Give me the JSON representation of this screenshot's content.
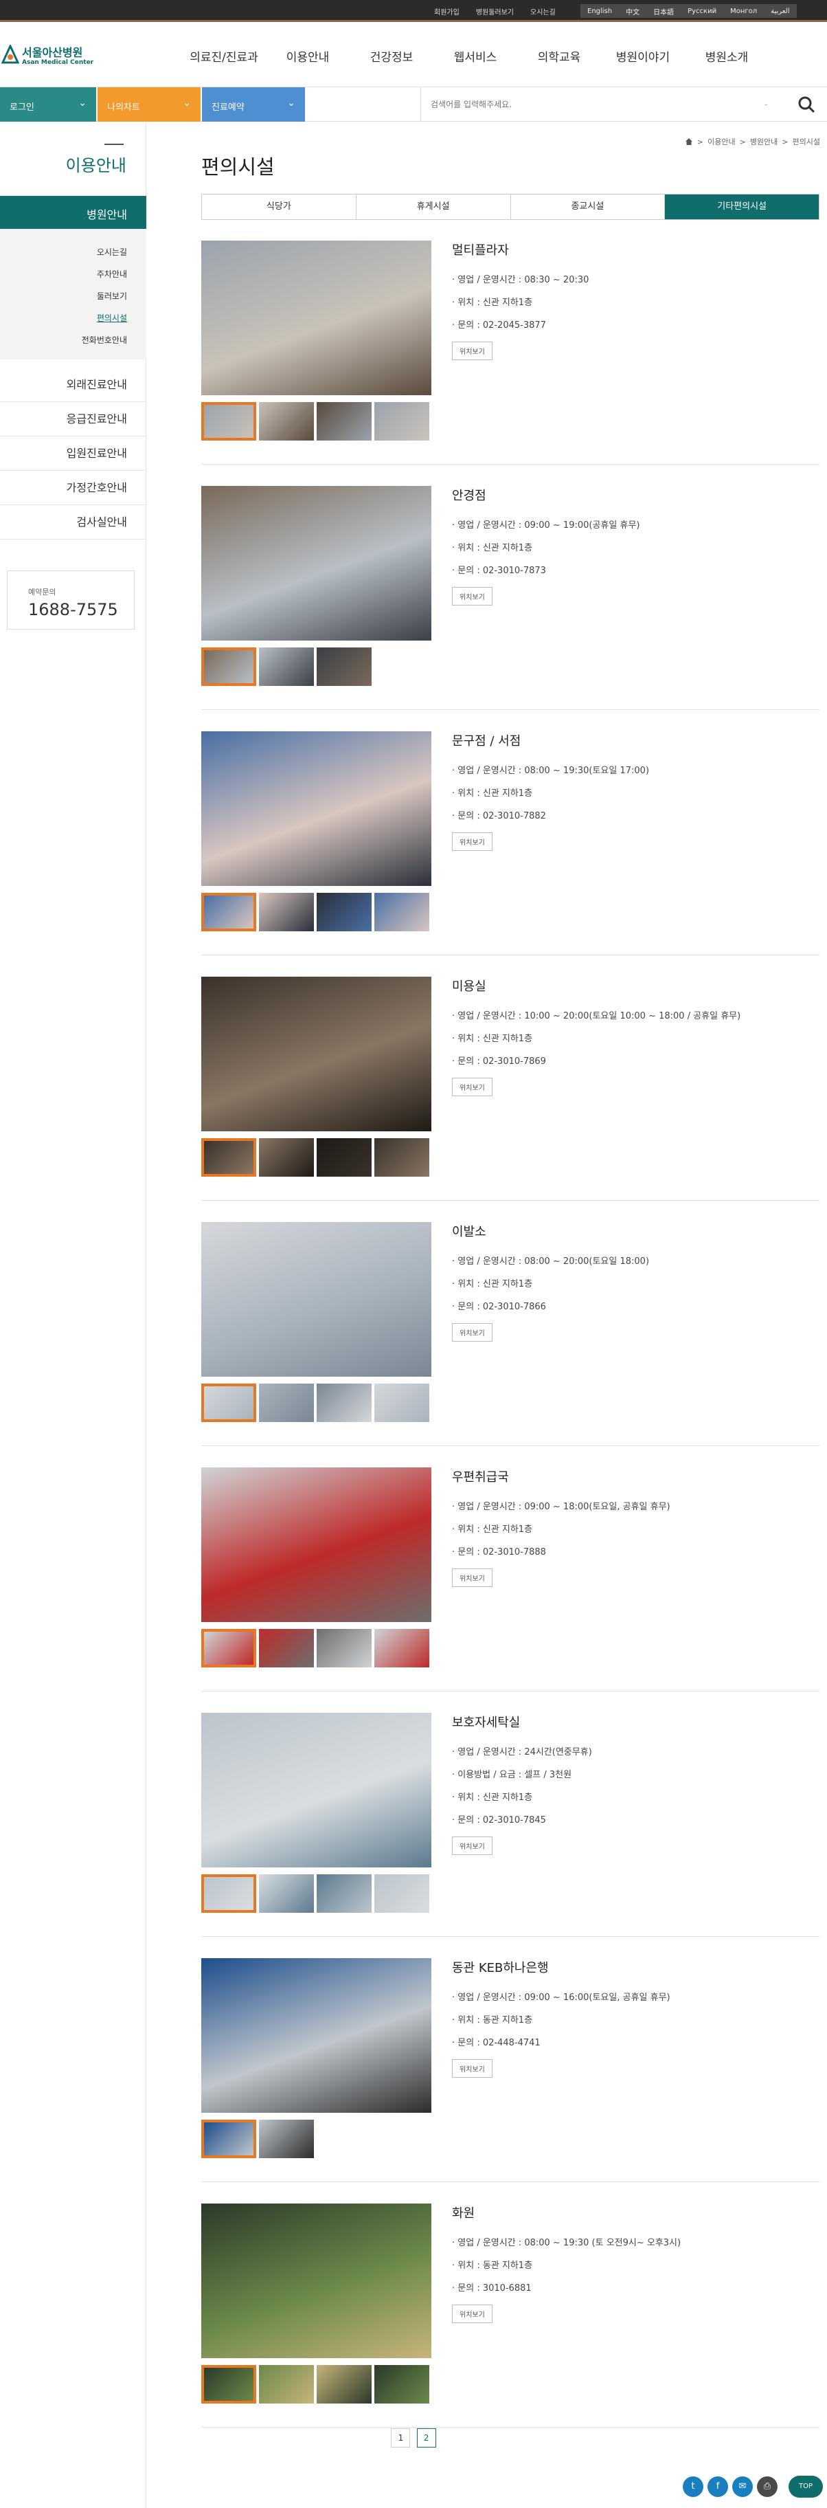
{
  "topbar": {
    "util_links": [
      "회원가입",
      "병원둘러보기",
      "오시는길"
    ],
    "languages": [
      "English",
      "中文",
      "日本語",
      "Pусский",
      "Монгол",
      "العربية"
    ]
  },
  "logo": {
    "name_ko": "서울아산병원",
    "name_en": "Asan Medical Center"
  },
  "gnb": {
    "menus": [
      "의료진/진료과",
      "이용안내",
      "건강정보",
      "웹서비스",
      "의학교육",
      "병원이야기",
      "병원소개"
    ]
  },
  "quick": {
    "login": "로그인",
    "mychart": "나의차트",
    "reservation": "진료예약"
  },
  "search": {
    "placeholder": "검색어를 입력해주세요.",
    "selector": "-"
  },
  "colors": {
    "primary": "#0f6d6b",
    "accent": "#e87722",
    "login_bg": "#2a8a86",
    "mychart_bg": "#f39a2d",
    "reservation_bg": "#4d8fd0"
  },
  "lnb": {
    "title": "이용안내",
    "active_category": "병원안내",
    "sub_items": [
      "오시는길",
      "주차안내",
      "둘러보기",
      "편의시설",
      "전화번호안내"
    ],
    "active_sub": "편의시설",
    "categories": [
      "외래진료안내",
      "응급진료안내",
      "입원진료안내",
      "가정간호안내",
      "검사실안내"
    ],
    "call": {
      "label": "예약문의",
      "number": "1688-7575"
    }
  },
  "breadcrumb": [
    "이용안내",
    "병원안내",
    "편의시설"
  ],
  "page_title": "편의시설",
  "tabs": [
    "식당가",
    "휴게시설",
    "종교시설",
    "기타편의시설"
  ],
  "active_tab": "기타편의시설",
  "map_button": "위치보기",
  "facilities": [
    {
      "name": "멀티플라자",
      "lines": [
        "· 영업 / 운영시간 : 08:30 ~ 20:30",
        "· 위치 : 신관 지하1층",
        "· 문의 : 02-2045-3877"
      ],
      "thumb_count": 4
    },
    {
      "name": "안경점",
      "lines": [
        "· 영업 / 운영시간 : 09:00 ~ 19:00(공휴일 휴무)",
        "· 위치 : 신관 지하1층",
        "· 문의 : 02-3010-7873"
      ],
      "thumb_count": 3
    },
    {
      "name": "문구점 / 서점",
      "lines": [
        "· 영업 / 운영시간 : 08:00 ~ 19:30(토요일 17:00)",
        "· 위치 : 신관 지하1층",
        "· 문의 : 02-3010-7882"
      ],
      "thumb_count": 4
    },
    {
      "name": "미용실",
      "lines": [
        "· 영업 / 운영시간 : 10:00 ~ 20:00(토요일 10:00 ~ 18:00 / 공휴일 휴무)",
        "· 위치 : 신관 지하1층",
        "· 문의 : 02-3010-7869"
      ],
      "thumb_count": 4
    },
    {
      "name": "이발소",
      "lines": [
        "· 영업 / 운영시간 : 08:00 ~ 20:00(토요일 18:00)",
        "· 위치 : 신관 지하1층",
        "· 문의 : 02-3010-7866"
      ],
      "thumb_count": 4
    },
    {
      "name": "우편취급국",
      "lines": [
        "· 영업 / 운영시간 : 09:00 ~ 18:00(토요일, 공휴일 휴무)",
        "· 위치 : 신관 지하1층",
        "· 문의 : 02-3010-7888"
      ],
      "thumb_count": 4
    },
    {
      "name": "보호자세탁실",
      "lines": [
        "· 영업 / 운영시간 : 24시간(연중무휴)",
        "· 이용방법 / 요금 : 셀프 / 3천원",
        "· 위치 : 신관 지하1층",
        "· 문의 : 02-3010-7845"
      ],
      "thumb_count": 4
    },
    {
      "name": "동관 KEB하나은행",
      "lines": [
        "· 영업 / 운영시간 : 09:00 ~ 16:00(토요일, 공휴일 휴무)",
        "· 위치 : 동관 지하1층",
        "· 문의 : 02-448-4741"
      ],
      "thumb_count": 2
    },
    {
      "name": "화원",
      "lines": [
        "· 영업 / 운영시간 : 08:00 ~ 19:30 (토 오전9시~ 오후3시)",
        "· 위치 : 동관 지하1층",
        "· 문의 : 3010-6881"
      ],
      "thumb_count": 4
    }
  ],
  "pagination": {
    "pages": [
      "1",
      "2"
    ],
    "current": "2"
  },
  "social_icons": [
    "twitter-icon",
    "facebook-icon",
    "mail-icon",
    "print-icon"
  ],
  "top_button": "TOP"
}
